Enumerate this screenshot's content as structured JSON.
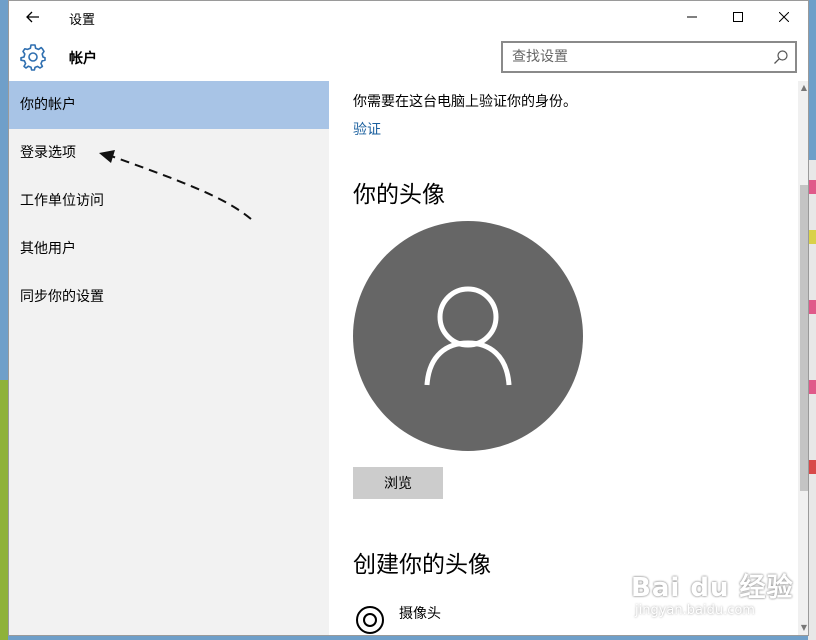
{
  "window": {
    "title": "设置",
    "controls": {
      "minimize": "minimize",
      "maximize": "maximize",
      "close": "close"
    }
  },
  "header": {
    "title": "帐户",
    "icon": "gear-icon",
    "search": {
      "placeholder": "查找设置",
      "value": ""
    }
  },
  "sidebar": {
    "items": [
      {
        "label": "你的帐户",
        "active": true
      },
      {
        "label": "登录选项",
        "active": false
      },
      {
        "label": "工作单位访问",
        "active": false
      },
      {
        "label": "其他用户",
        "active": false
      },
      {
        "label": "同步你的设置",
        "active": false
      }
    ]
  },
  "content": {
    "verify_text": "你需要在这台电脑上验证你的身份。",
    "verify_link": "验证",
    "avatar_heading": "你的头像",
    "browse_label": "浏览",
    "create_heading": "创建你的头像",
    "camera_label": "摄像头"
  },
  "watermark": {
    "main": "Bai du 经验",
    "sub": "jingyan.baidu.com"
  },
  "colors": {
    "active_nav": "#a8c4e6",
    "sidebar_bg": "#f2f2f2",
    "link": "#1a5f9e",
    "avatar_bg": "#666666",
    "button_bg": "#cccccc"
  }
}
